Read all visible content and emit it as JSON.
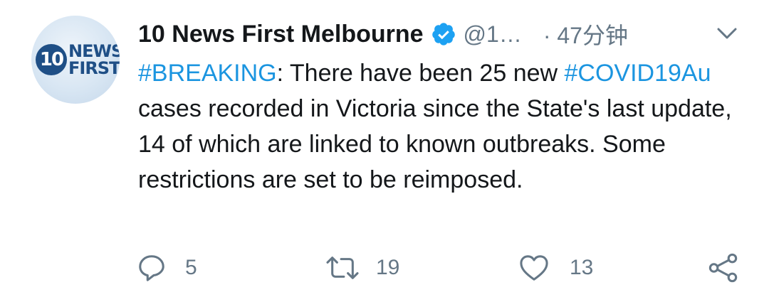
{
  "tweet": {
    "author_name": "10 News First Melbourne",
    "handle": "@1…",
    "time": "· 47分钟",
    "avatar_logo": {
      "numeral": "10",
      "line1": "NEWS",
      "line2": "FIRST"
    },
    "text": {
      "hashtag1": "#BREAKING",
      "segment1": ": There have been 25 new ",
      "hashtag2": "#COVID19Au",
      "segment2": " cases recorded in Victoria since the State's last update, 14 of which are linked to known outbreaks. Some restrictions are set to be reimposed."
    },
    "actions": {
      "reply_count": "5",
      "retweet_count": "19",
      "like_count": "13"
    }
  },
  "icons": {
    "verified": "verified-badge-icon",
    "more": "chevron-down-icon",
    "reply": "reply-icon",
    "retweet": "retweet-icon",
    "like": "heart-icon",
    "share": "share-icon"
  },
  "colors": {
    "hashtag": "#1b95e0",
    "secondary_text": "#657786",
    "verified": "#1da1f2",
    "logo_blue": "#1f4f86"
  }
}
